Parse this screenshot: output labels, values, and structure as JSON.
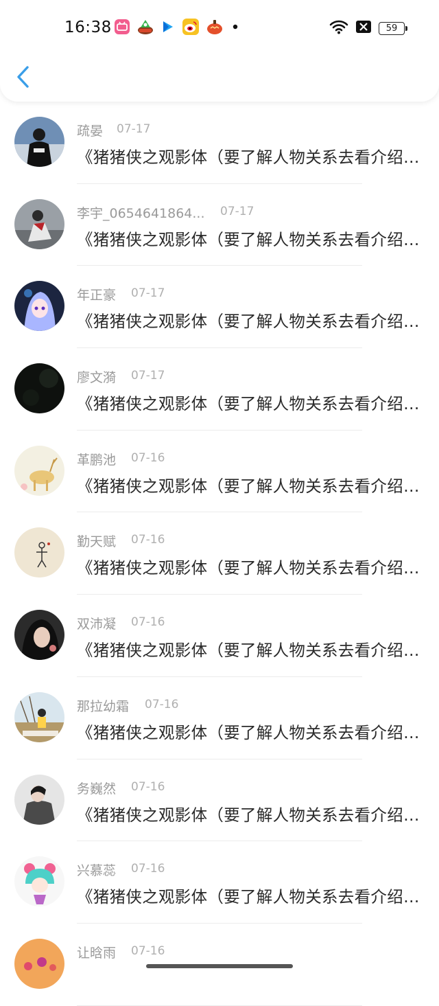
{
  "status_bar": {
    "time": "16:38",
    "notification_icons": [
      "bilibili-icon",
      "game-icon",
      "video-icon",
      "weibo-icon",
      "app-icon",
      "dot-icon"
    ],
    "battery": "59"
  },
  "nav": {
    "back_icon": "chevron-left-icon",
    "accent_color": "#3a9ee8"
  },
  "messages": [
    {
      "name": "疏晏",
      "date": "07-17",
      "text": "《猪猪侠之观影体（要了解人物关系去看介绍）》"
    },
    {
      "name": "李宇_0654641864...",
      "date": "07-17",
      "text": "《猪猪侠之观影体（要了解人物关系去看介绍）》"
    },
    {
      "name": "年正豪",
      "date": "07-17",
      "text": "《猪猪侠之观影体（要了解人物关系去看介绍）》"
    },
    {
      "name": "廖文漪",
      "date": "07-17",
      "text": "《猪猪侠之观影体（要了解人物关系去看介绍）》"
    },
    {
      "name": "革鹏池",
      "date": "07-16",
      "text": "《猪猪侠之观影体（要了解人物关系去看介绍）》"
    },
    {
      "name": "勤天赋",
      "date": "07-16",
      "text": "《猪猪侠之观影体（要了解人物关系去看介绍）》"
    },
    {
      "name": "双沛凝",
      "date": "07-16",
      "text": "《猪猪侠之观影体（要了解人物关系去看介绍）》"
    },
    {
      "name": "那拉幼霜",
      "date": "07-16",
      "text": "《猪猪侠之观影体（要了解人物关系去看介绍）》"
    },
    {
      "name": "务巍然",
      "date": "07-16",
      "text": "《猪猪侠之观影体（要了解人物关系去看介绍）》"
    },
    {
      "name": "兴慕蕊",
      "date": "07-16",
      "text": "《猪猪侠之观影体（要了解人物关系去看介绍）》"
    },
    {
      "name": "让晗雨",
      "date": "07-16",
      "text": ""
    }
  ]
}
